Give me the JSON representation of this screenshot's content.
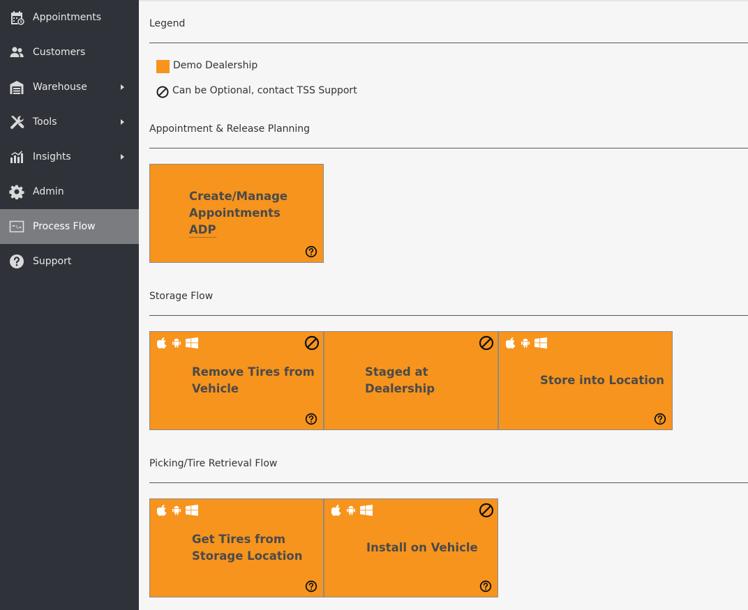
{
  "sidebar": {
    "items": [
      {
        "label": "Appointments",
        "icon": "calendar-clock-icon",
        "has_submenu": false,
        "active": false
      },
      {
        "label": "Customers",
        "icon": "users-icon",
        "has_submenu": false,
        "active": false
      },
      {
        "label": "Warehouse",
        "icon": "warehouse-icon",
        "has_submenu": true,
        "active": false
      },
      {
        "label": "Tools",
        "icon": "tools-icon",
        "has_submenu": true,
        "active": false
      },
      {
        "label": "Insights",
        "icon": "insights-chart-icon",
        "has_submenu": true,
        "active": false
      },
      {
        "label": "Admin",
        "icon": "gear-icon",
        "has_submenu": false,
        "active": false
      },
      {
        "label": "Process Flow",
        "icon": "process-flow-icon",
        "has_submenu": false,
        "active": true
      },
      {
        "label": "Support",
        "icon": "question-circle-icon",
        "has_submenu": false,
        "active": false
      }
    ]
  },
  "colors": {
    "sidebar_bg": "#2f3238",
    "sidebar_active": "#7a7c80",
    "card_orange": "#f7941d",
    "page_bg": "#f6f6f6"
  },
  "legend": {
    "title": "Legend",
    "demo_dealership": "Demo Dealership",
    "optional_note": "Can be Optional, contact TSS Support"
  },
  "sections": {
    "appointment": {
      "title": "Appointment & Release Planning",
      "cards": [
        {
          "lines": [
            "Create/Manage",
            "Appointments"
          ],
          "link": "ADP",
          "platforms": false,
          "optional": false
        }
      ]
    },
    "storage": {
      "title": "Storage Flow",
      "cards": [
        {
          "lines": [
            "Remove Tires from",
            "Vehicle"
          ],
          "platforms": true,
          "optional": true
        },
        {
          "lines": [
            "Staged at",
            "Dealership"
          ],
          "platforms": false,
          "optional": true
        },
        {
          "lines": [
            "Store into Location"
          ],
          "platforms": true,
          "optional": false
        }
      ]
    },
    "picking": {
      "title": "Picking/Tire Retrieval Flow",
      "cards": [
        {
          "lines": [
            "Get Tires from",
            "Storage Location"
          ],
          "platforms": true,
          "optional": false
        },
        {
          "lines": [
            "Install on Vehicle"
          ],
          "platforms": true,
          "optional": true
        }
      ]
    }
  },
  "platform_icons": [
    "apple-icon",
    "android-icon",
    "windows-icon"
  ]
}
